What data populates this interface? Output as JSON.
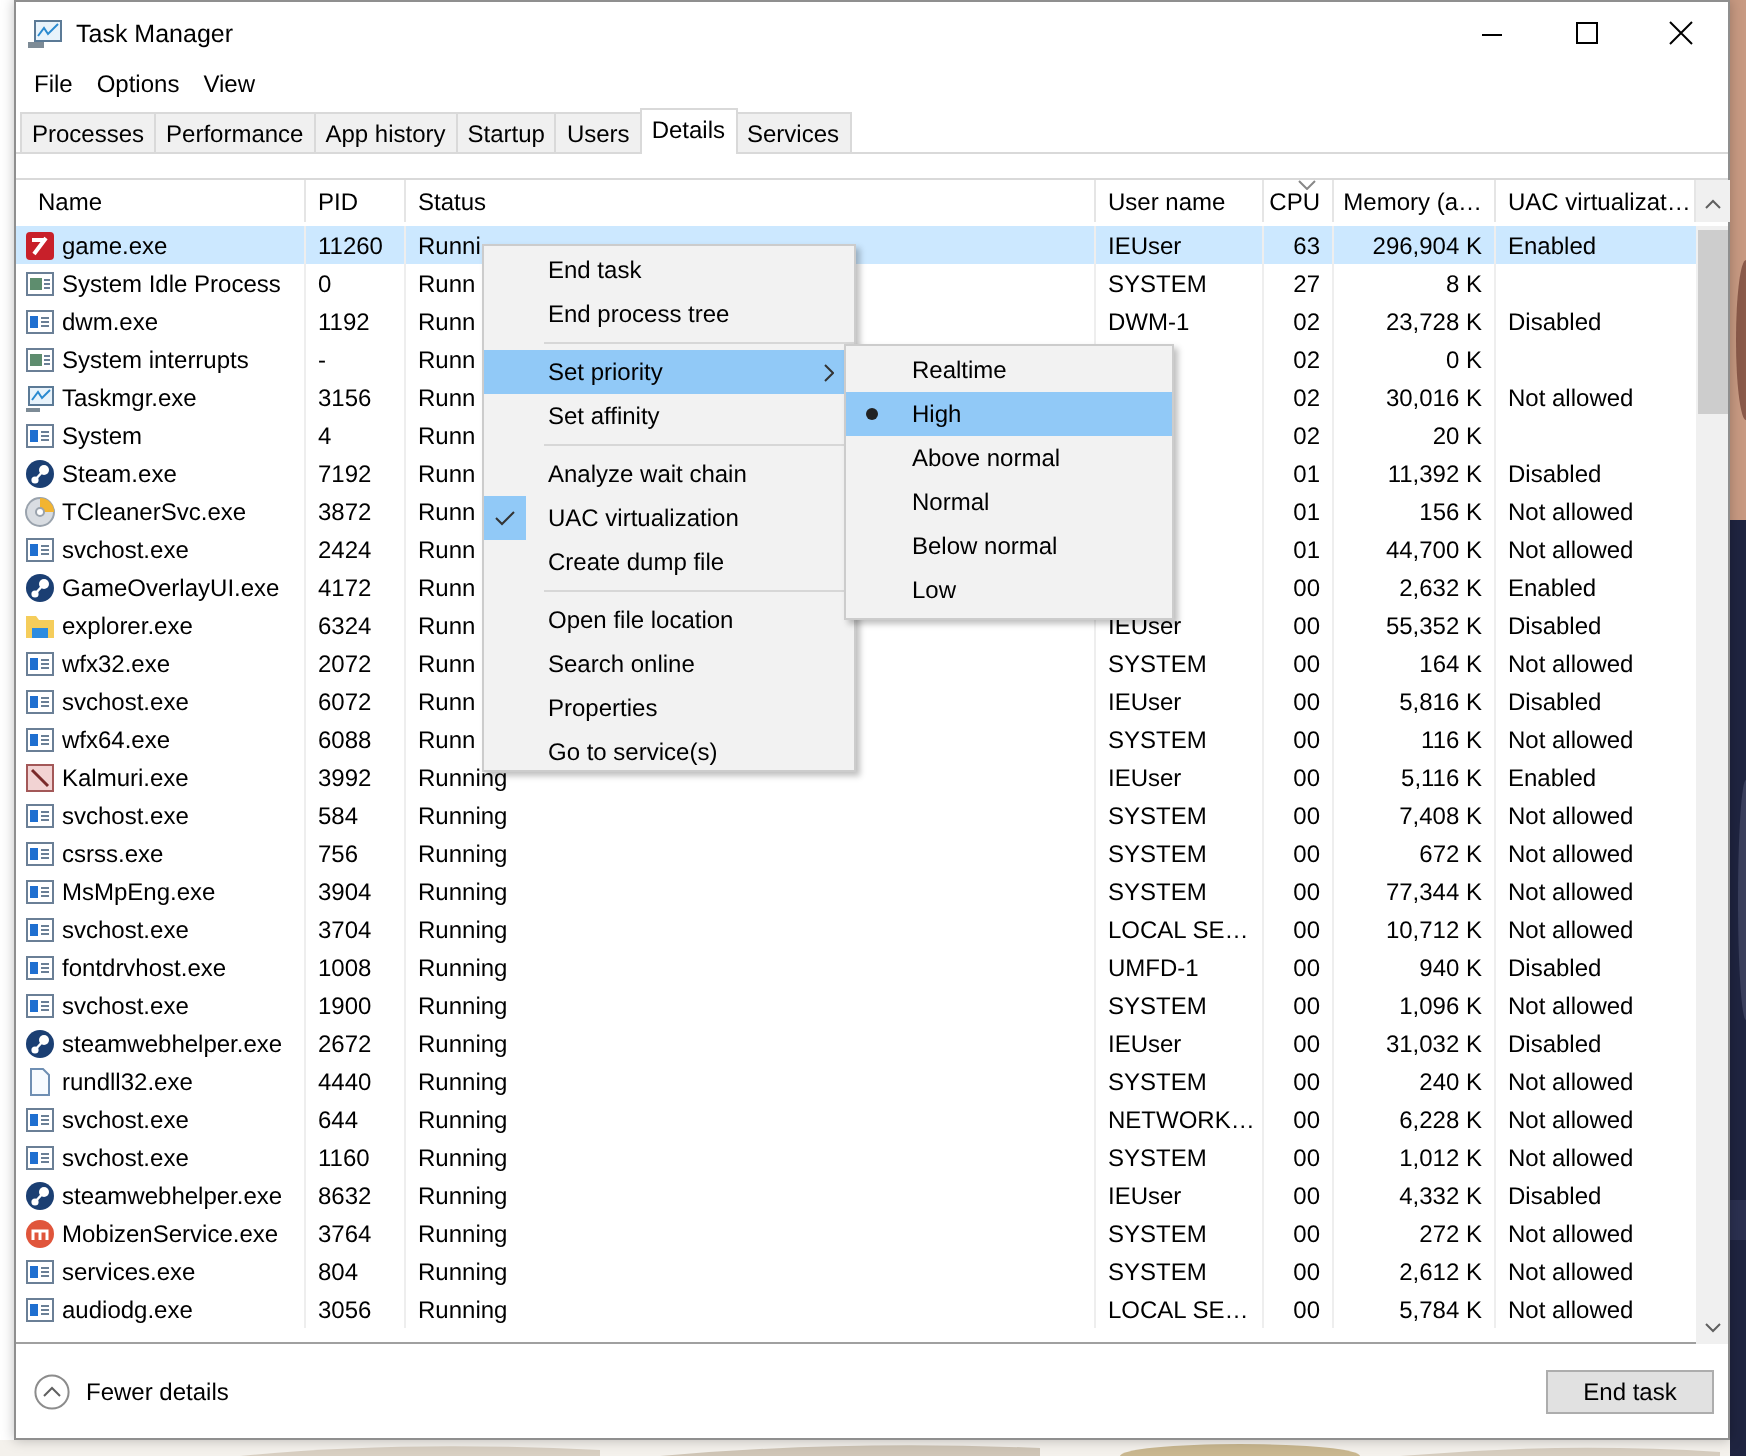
{
  "window": {
    "title": "Task Manager"
  },
  "menu_bar": [
    "File",
    "Options",
    "View"
  ],
  "tabs": [
    {
      "label": "Processes",
      "selected": false
    },
    {
      "label": "Performance",
      "selected": false
    },
    {
      "label": "App history",
      "selected": false
    },
    {
      "label": "Startup",
      "selected": false
    },
    {
      "label": "Users",
      "selected": false
    },
    {
      "label": "Details",
      "selected": true
    },
    {
      "label": "Services",
      "selected": false
    }
  ],
  "table": {
    "columns": [
      {
        "label": "Name",
        "sorted": false
      },
      {
        "label": "PID",
        "sorted": false
      },
      {
        "label": "Status",
        "sorted": false
      },
      {
        "label": "User name",
        "sorted": false
      },
      {
        "label": "CPU",
        "sorted": true
      },
      {
        "label": "Memory (a…",
        "sorted": false
      },
      {
        "label": "UAC virtualizat…",
        "sorted": false
      }
    ],
    "rows": [
      {
        "kind": "game",
        "name": "game.exe",
        "pid": "11260",
        "status": "Runni",
        "user": "IEUser",
        "cpu": "63",
        "memory": "296,904 K",
        "uac": "Enabled",
        "selected": true
      },
      {
        "kind": "system",
        "name": "System Idle Process",
        "pid": "0",
        "status": "Runn",
        "user": "SYSTEM",
        "cpu": "27",
        "memory": "8 K",
        "selected": false
      },
      {
        "kind": "exe",
        "name": "dwm.exe",
        "pid": "1192",
        "status": "Runn",
        "user": "DWM-1",
        "cpu": "02",
        "memory": "23,728 K",
        "uac": "Disabled",
        "selected": false
      },
      {
        "kind": "system",
        "name": "System interrupts",
        "pid": "-",
        "status": "Runn",
        "cpu": "02",
        "memory": "0 K",
        "selected": false
      },
      {
        "kind": "taskmgr",
        "name": "Taskmgr.exe",
        "pid": "3156",
        "status": "Runn",
        "cpu": "02",
        "memory": "30,016 K",
        "uac": "Not allowed",
        "selected": false
      },
      {
        "kind": "exe",
        "name": "System",
        "pid": "4",
        "status": "Runn",
        "cpu": "02",
        "memory": "20 K",
        "selected": false
      },
      {
        "kind": "steam",
        "name": "Steam.exe",
        "pid": "7192",
        "status": "Runn",
        "cpu": "01",
        "memory": "11,392 K",
        "uac": "Disabled",
        "selected": false
      },
      {
        "kind": "disc",
        "name": "TCleanerSvc.exe",
        "pid": "3872",
        "status": "Runn",
        "cpu": "01",
        "memory": "156 K",
        "uac": "Not allowed",
        "selected": false
      },
      {
        "kind": "exe",
        "name": "svchost.exe",
        "pid": "2424",
        "status": "Runn",
        "cpu": "01",
        "memory": "44,700 K",
        "uac": "Not allowed",
        "selected": false
      },
      {
        "kind": "steam",
        "name": "GameOverlayUI.exe",
        "pid": "4172",
        "status": "Runn",
        "cpu": "00",
        "memory": "2,632 K",
        "uac": "Enabled",
        "selected": false
      },
      {
        "kind": "folder",
        "name": "explorer.exe",
        "pid": "6324",
        "status": "Runn",
        "user": "IEUser",
        "cpu": "00",
        "memory": "55,352 K",
        "uac": "Disabled",
        "selected": false
      },
      {
        "kind": "exe",
        "name": "wfx32.exe",
        "pid": "2072",
        "status": "Runn",
        "user": "SYSTEM",
        "cpu": "00",
        "memory": "164 K",
        "uac": "Not allowed",
        "selected": false
      },
      {
        "kind": "exe",
        "name": "svchost.exe",
        "pid": "6072",
        "status": "Runn",
        "user": "IEUser",
        "cpu": "00",
        "memory": "5,816 K",
        "uac": "Disabled",
        "selected": false
      },
      {
        "kind": "exe",
        "name": "wfx64.exe",
        "pid": "6088",
        "status": "Runn",
        "user": "SYSTEM",
        "cpu": "00",
        "memory": "116 K",
        "uac": "Not allowed",
        "selected": false
      },
      {
        "kind": "pen",
        "name": "Kalmuri.exe",
        "pid": "3992",
        "status": "Running",
        "user": "IEUser",
        "cpu": "00",
        "memory": "5,116 K",
        "uac": "Enabled",
        "selected": false
      },
      {
        "kind": "exe",
        "name": "svchost.exe",
        "pid": "584",
        "status": "Running",
        "user": "SYSTEM",
        "cpu": "00",
        "memory": "7,408 K",
        "uac": "Not allowed",
        "selected": false
      },
      {
        "kind": "exe",
        "name": "csrss.exe",
        "pid": "756",
        "status": "Running",
        "user": "SYSTEM",
        "cpu": "00",
        "memory": "672 K",
        "uac": "Not allowed",
        "selected": false
      },
      {
        "kind": "exe",
        "name": "MsMpEng.exe",
        "pid": "3904",
        "status": "Running",
        "user": "SYSTEM",
        "cpu": "00",
        "memory": "77,344 K",
        "uac": "Not allowed",
        "selected": false
      },
      {
        "kind": "exe",
        "name": "svchost.exe",
        "pid": "3704",
        "status": "Running",
        "user": "LOCAL SE…",
        "cpu": "00",
        "memory": "10,712 K",
        "uac": "Not allowed",
        "selected": false
      },
      {
        "kind": "exe",
        "name": "fontdrvhost.exe",
        "pid": "1008",
        "status": "Running",
        "user": "UMFD-1",
        "cpu": "00",
        "memory": "940 K",
        "uac": "Disabled",
        "selected": false
      },
      {
        "kind": "exe",
        "name": "svchost.exe",
        "pid": "1900",
        "status": "Running",
        "user": "SYSTEM",
        "cpu": "00",
        "memory": "1,096 K",
        "uac": "Not allowed",
        "selected": false
      },
      {
        "kind": "steam",
        "name": "steamwebhelper.exe",
        "pid": "2672",
        "status": "Running",
        "user": "IEUser",
        "cpu": "00",
        "memory": "31,032 K",
        "uac": "Disabled",
        "selected": false
      },
      {
        "kind": "file",
        "name": "rundll32.exe",
        "pid": "4440",
        "status": "Running",
        "user": "SYSTEM",
        "cpu": "00",
        "memory": "240 K",
        "uac": "Not allowed",
        "selected": false
      },
      {
        "kind": "exe",
        "name": "svchost.exe",
        "pid": "644",
        "status": "Running",
        "user": "NETWORK…",
        "cpu": "00",
        "memory": "6,228 K",
        "uac": "Not allowed",
        "selected": false
      },
      {
        "kind": "exe",
        "name": "svchost.exe",
        "pid": "1160",
        "status": "Running",
        "user": "SYSTEM",
        "cpu": "00",
        "memory": "1,012 K",
        "uac": "Not allowed",
        "selected": false
      },
      {
        "kind": "steam",
        "name": "steamwebhelper.exe",
        "pid": "8632",
        "status": "Running",
        "user": "IEUser",
        "cpu": "00",
        "memory": "4,332 K",
        "uac": "Disabled",
        "selected": false
      },
      {
        "kind": "mobizen",
        "name": "MobizenService.exe",
        "pid": "3764",
        "status": "Running",
        "user": "SYSTEM",
        "cpu": "00",
        "memory": "272 K",
        "uac": "Not allowed",
        "selected": false
      },
      {
        "kind": "exe",
        "name": "services.exe",
        "pid": "804",
        "status": "Running",
        "user": "SYSTEM",
        "cpu": "00",
        "memory": "2,612 K",
        "uac": "Not allowed",
        "selected": false
      },
      {
        "kind": "exe",
        "name": "audiodg.exe",
        "pid": "3056",
        "status": "Running",
        "user": "LOCAL SE…",
        "cpu": "00",
        "memory": "5,784 K",
        "uac": "Not allowed",
        "selected": false
      }
    ]
  },
  "context_menu": {
    "groups": [
      [
        {
          "label": "End task",
          "highlighted": false,
          "checked": false,
          "has_submenu": false
        },
        {
          "label": "End process tree",
          "highlighted": false,
          "checked": false,
          "has_submenu": false
        }
      ],
      [
        {
          "label": "Set priority",
          "highlighted": true,
          "checked": false,
          "has_submenu": true
        },
        {
          "label": "Set affinity",
          "highlighted": false,
          "checked": false,
          "has_submenu": false
        }
      ],
      [
        {
          "label": "Analyze wait chain",
          "highlighted": false,
          "checked": false,
          "has_submenu": false
        },
        {
          "label": "UAC virtualization",
          "highlighted": false,
          "checked": true,
          "has_submenu": false
        },
        {
          "label": "Create dump file",
          "highlighted": false,
          "checked": false,
          "has_submenu": false
        }
      ],
      [
        {
          "label": "Open file location",
          "highlighted": false,
          "checked": false,
          "has_submenu": false
        },
        {
          "label": "Search online",
          "highlighted": false,
          "checked": false,
          "has_submenu": false
        },
        {
          "label": "Properties",
          "highlighted": false,
          "checked": false,
          "has_submenu": false
        },
        {
          "label": "Go to service(s)",
          "highlighted": false,
          "checked": false,
          "has_submenu": false
        }
      ]
    ]
  },
  "priority_submenu": [
    {
      "label": "Realtime",
      "highlighted": false,
      "checked": false
    },
    {
      "label": "High",
      "highlighted": true,
      "checked": true
    },
    {
      "label": "Above normal",
      "highlighted": false,
      "checked": false
    },
    {
      "label": "Normal",
      "highlighted": false,
      "checked": false
    },
    {
      "label": "Below normal",
      "highlighted": false,
      "checked": false
    },
    {
      "label": "Low",
      "highlighted": false,
      "checked": false
    }
  ],
  "footer": {
    "details_toggle": "Fewer details",
    "end_task_button": "End task"
  }
}
